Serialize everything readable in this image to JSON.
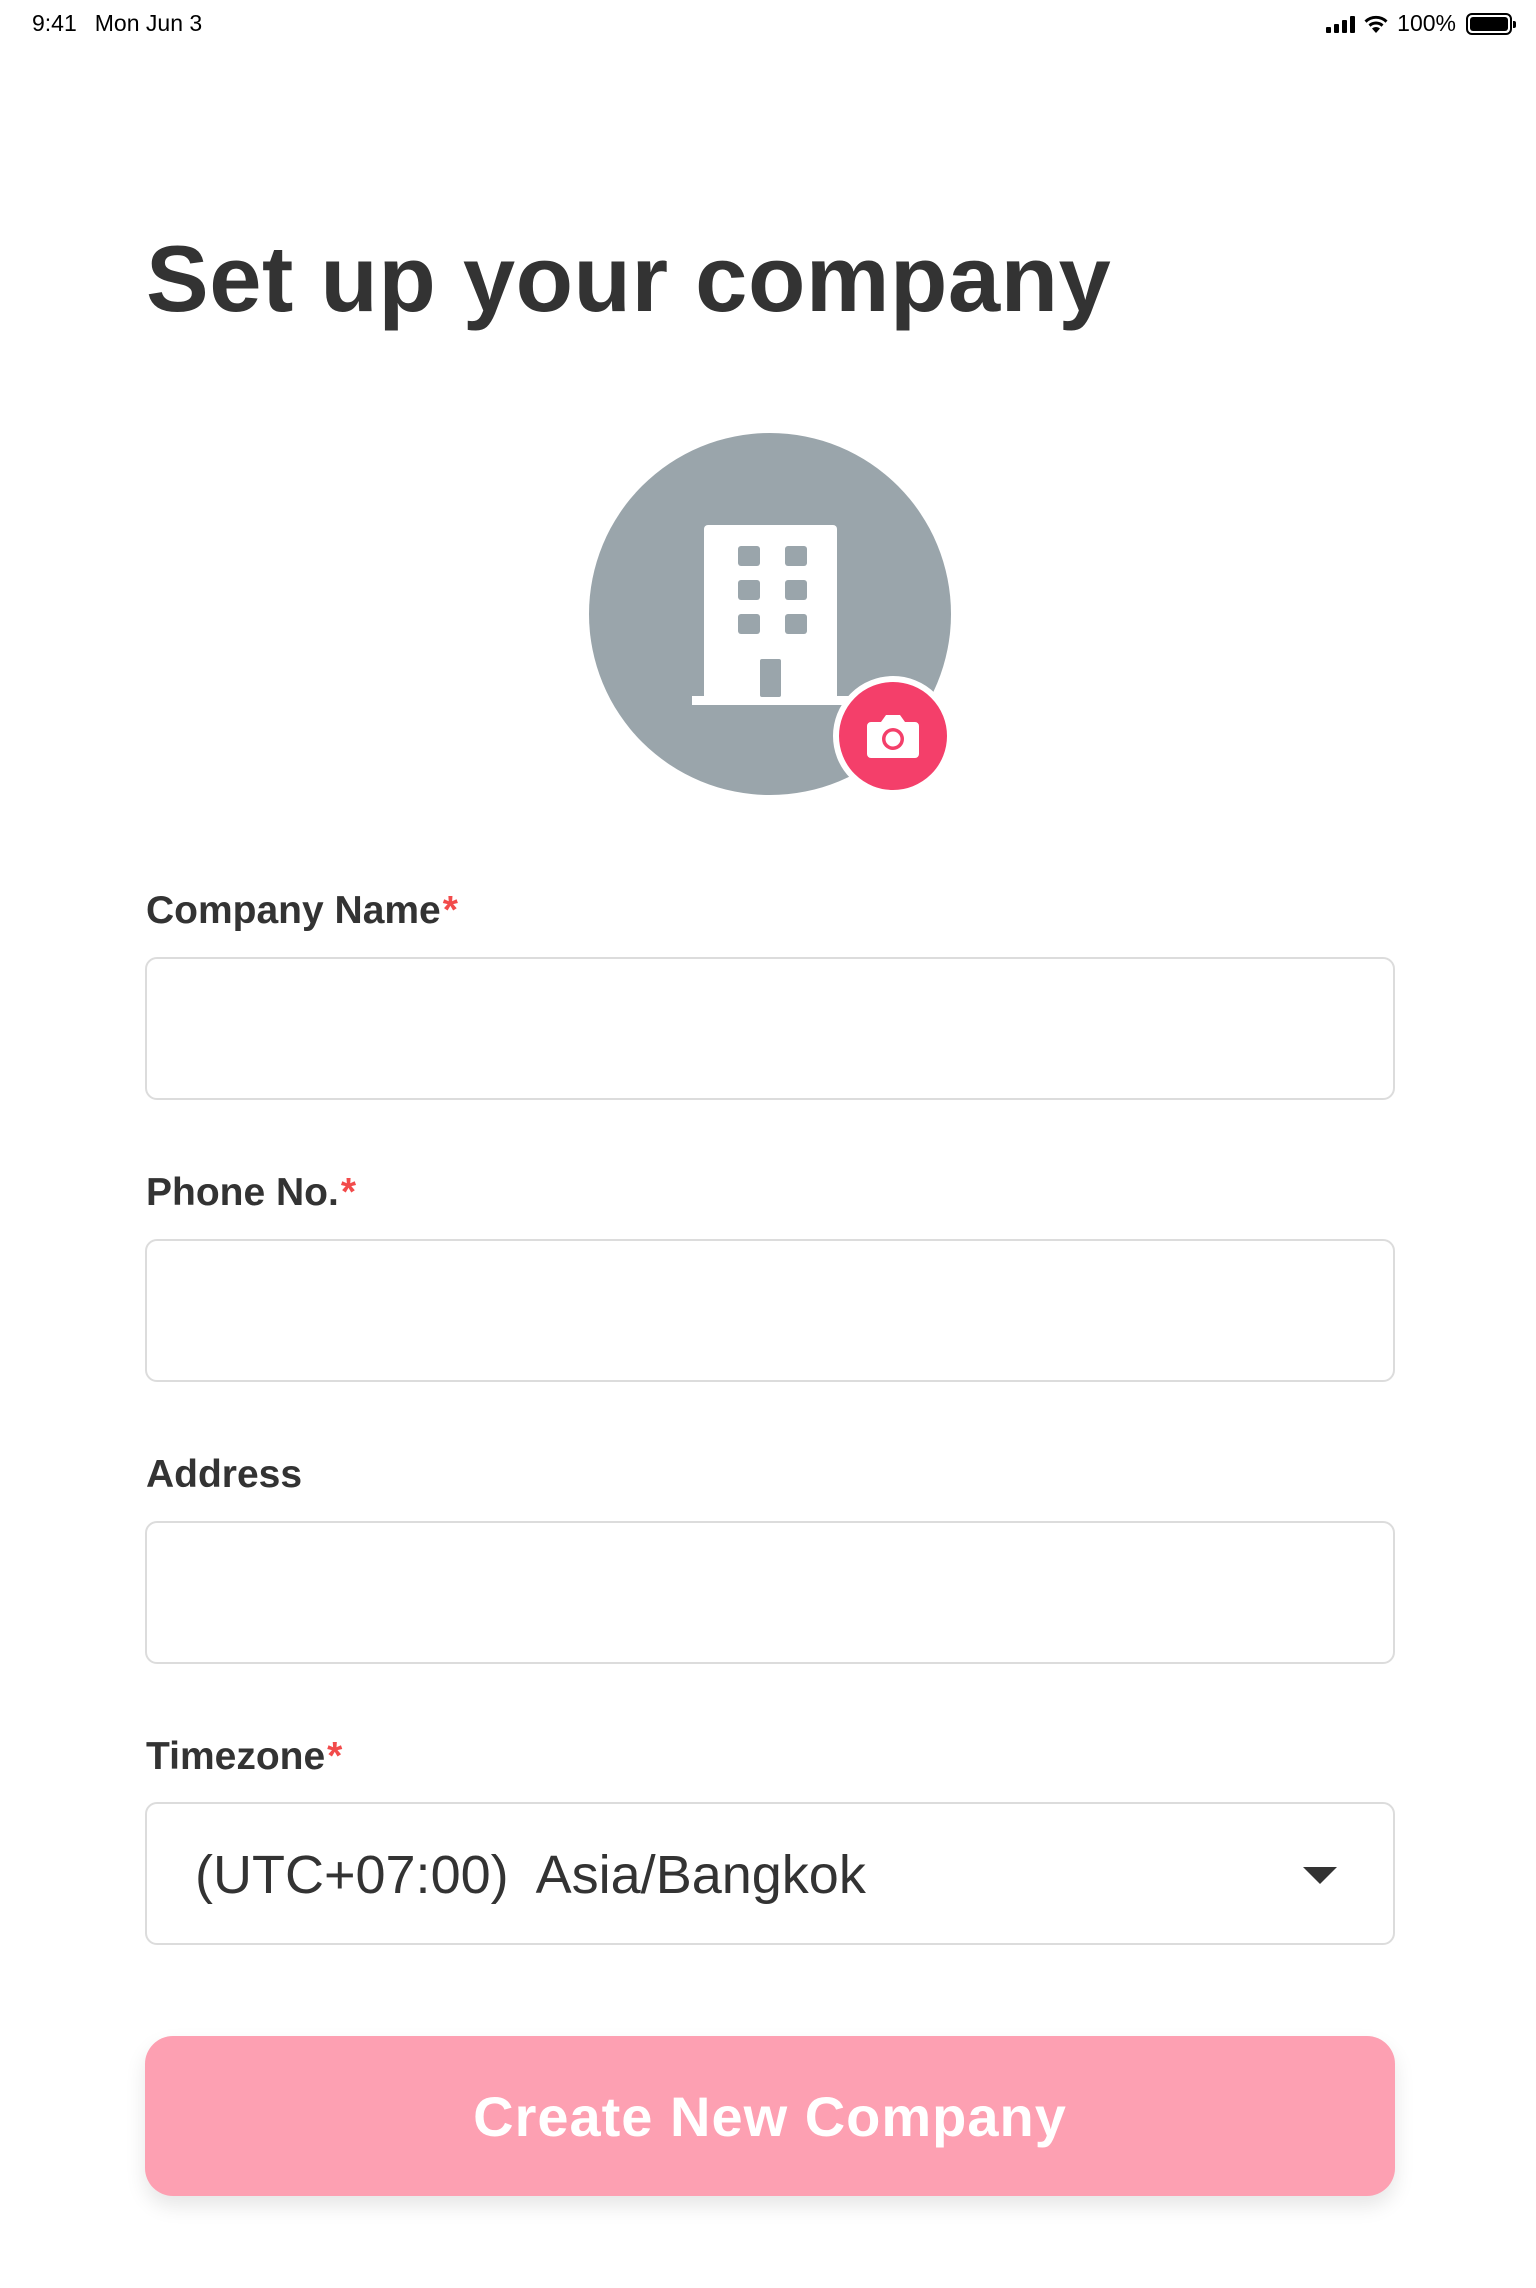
{
  "status_bar": {
    "time": "9:41",
    "date": "Mon Jun 3",
    "battery_percent_text": "100%",
    "battery_level": 1.0,
    "icons": [
      "signal-icon",
      "wifi-icon",
      "battery-icon"
    ]
  },
  "title": "Set up your company",
  "avatar": {
    "placeholder_icon": "building-icon",
    "camera_icon": "camera-icon",
    "colors": {
      "circle": "#9aa5ab",
      "camera_button": "#f43f6a"
    }
  },
  "form": {
    "company_name": {
      "label": "Company Name",
      "required_mark": "*",
      "value": "",
      "placeholder": ""
    },
    "phone": {
      "label": "Phone No.",
      "required_mark": "*",
      "value": "",
      "placeholder": ""
    },
    "address": {
      "label": "Address",
      "value": "",
      "placeholder": ""
    },
    "timezone": {
      "label": "Timezone",
      "required_mark": "*",
      "selected": "(UTC+07:00)  Asia/Bangkok",
      "icon": "chevron-down-icon"
    }
  },
  "submit": {
    "label": "Create New Company",
    "state": "disabled",
    "color": "#fda0b2"
  },
  "colors": {
    "text": "#333333",
    "required": "#f24b4b",
    "input_border": "#dcdcdc"
  }
}
